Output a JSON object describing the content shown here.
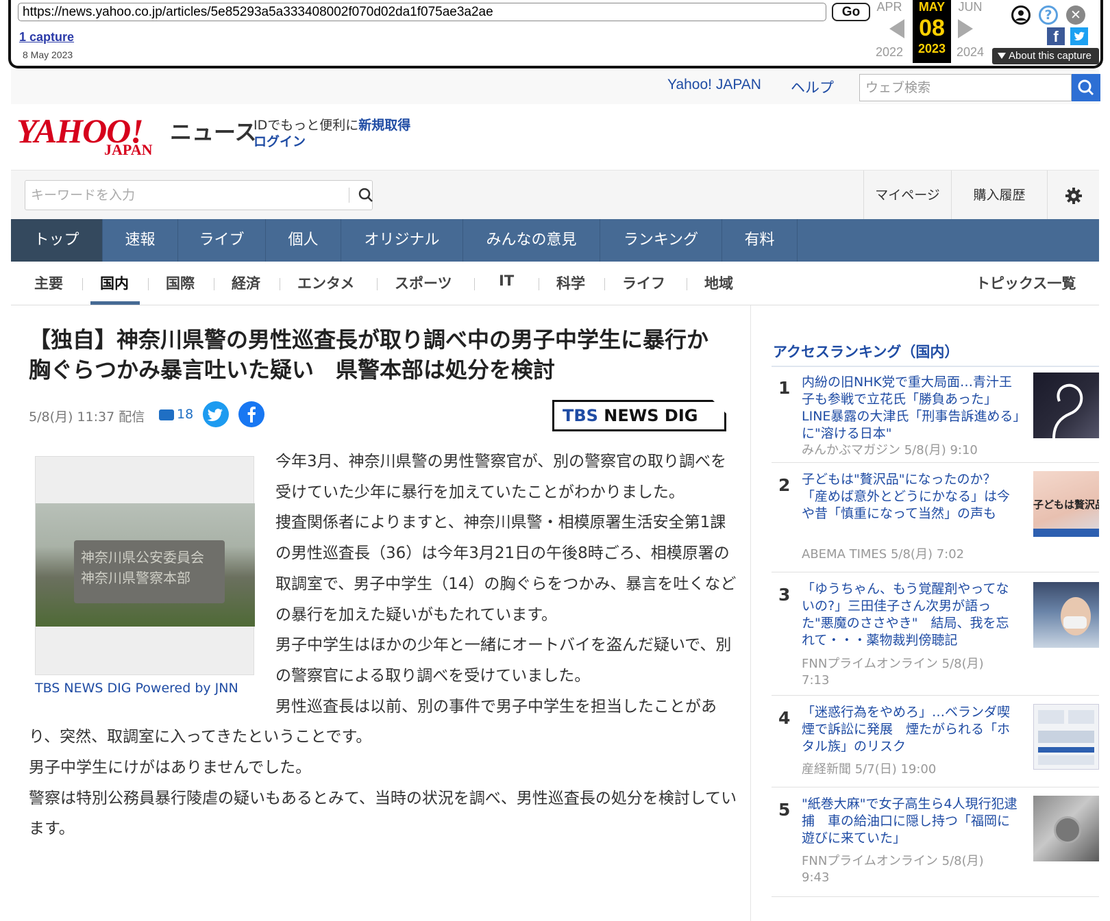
{
  "wayback": {
    "url": "https://news.yahoo.co.jp/articles/5e85293a5a333408002f070d02da1f075ae3a2ae",
    "go": "Go",
    "captures": "1 capture",
    "capture_date": "8 May 2023",
    "prev_month": "APR",
    "cur_month": "MAY",
    "next_month": "JUN",
    "cur_day": "08",
    "prev_year": "2022",
    "cur_year": "2023",
    "next_year": "2024",
    "about": "About this capture"
  },
  "util": {
    "yahoo_japan": "Yahoo! JAPAN",
    "help": "ヘルプ",
    "web_search_placeholder": "ウェブ検索"
  },
  "brand": {
    "logo": "YAHOO!",
    "logo_sub": "JAPAN",
    "news": "ニュース",
    "id_text": "IDでもっと便利に",
    "signup": "新規取得",
    "login": "ログイン"
  },
  "search": {
    "placeholder": "キーワードを入力",
    "mypage": "マイページ",
    "history": "購入履歴"
  },
  "main_nav": [
    "トップ",
    "速報",
    "ライブ",
    "個人",
    "オリジナル",
    "みんなの意見",
    "ランキング",
    "有料"
  ],
  "sub_nav": [
    "主要",
    "国内",
    "国際",
    "経済",
    "エンタメ",
    "スポーツ",
    "IT",
    "科学",
    "ライフ",
    "地域"
  ],
  "topics": "トピックス一覧",
  "article": {
    "title": "【独自】神奈川県警の男性巡査長が取り調べ中の男子中学生に暴行か　胸ぐらつかみ暴言吐いた疑い　県警本部は処分を検討",
    "date": "5/8(月) 11:37 配信",
    "comments": "18",
    "source_logo_a": "TBS",
    "source_logo_b": " NEWS DIG",
    "photo_text": "神奈川県公安委員会 神奈川県警察本部",
    "caption": "TBS NEWS DIG Powered by JNN",
    "paragraphs": [
      "今年3月、神奈川県警の男性警察官が、別の警察官の取り調べを受けていた少年に暴行を加えていたことがわかりました。",
      "捜査関係者によりますと、神奈川県警・相模原署生活安全第1課の男性巡査長（36）は今年3月21日の午後8時ごろ、相模原署の取調室で、男子中学生（14）の胸ぐらをつかみ、暴言を吐くなどの暴行を加えた疑いがもたれています。",
      "男子中学生はほかの少年と一緒にオートバイを盗んだ疑いで、別の警察官による取り調べを受けていました。",
      "男性巡査長は以前、別の事件で男子中学生を担当したことがあり、突然、取調室に入ってきたということです。",
      "男子中学生にけがはありませんでした。",
      "警察は特別公務員暴行陵虐の疑いもあるとみて、当時の状況を調べ、男性巡査長の処分を検討しています。"
    ]
  },
  "ranking": {
    "heading": "アクセスランキング（国内）",
    "items": [
      {
        "num": "1",
        "title": "内紛の旧NHK党で重大局面…青汁王子も参戦で立花氏「勝負あった」LINE暴露の大津氏「刑事告訴進める」に\"溶ける日本\"",
        "source": "みんかぶマガジン 5/8(月) 9:10"
      },
      {
        "num": "2",
        "title": "子どもは\"贅沢品\"になったのか？「産めば意外とどうにかなる」は今や昔「慎重になって当然」の声も",
        "source": "ABEMA TIMES 5/8(月) 7:02"
      },
      {
        "num": "3",
        "title": "「ゆうちゃん、もう覚醒剤やってないの?」三田佳子さん次男が語った\"悪魔のささやき\"　結局、我を忘れて・・・薬物裁判傍聴記",
        "source": "FNNプライムオンライン 5/8(月) 7:13"
      },
      {
        "num": "4",
        "title": "「迷惑行為をやめろ」…ベランダ喫煙で訴訟に発展　煙たがられる「ホタル族」のリスク",
        "source": "産経新聞 5/7(日) 19:00"
      },
      {
        "num": "5",
        "title": "\"紙巻大麻\"で女子高生ら4人現行犯逮捕　車の給油口に隠し持つ「福岡に遊びに来ていた」",
        "source": "FNNプライムオンライン 5/8(月) 9:43"
      }
    ],
    "thumb2_text": "子どもは贅沢品"
  },
  "colors": {
    "yahoo_red": "#d6001c",
    "link_blue": "#1f4ca4",
    "nav_blue": "#466a94",
    "wayback_yellow": "#ffd000"
  }
}
